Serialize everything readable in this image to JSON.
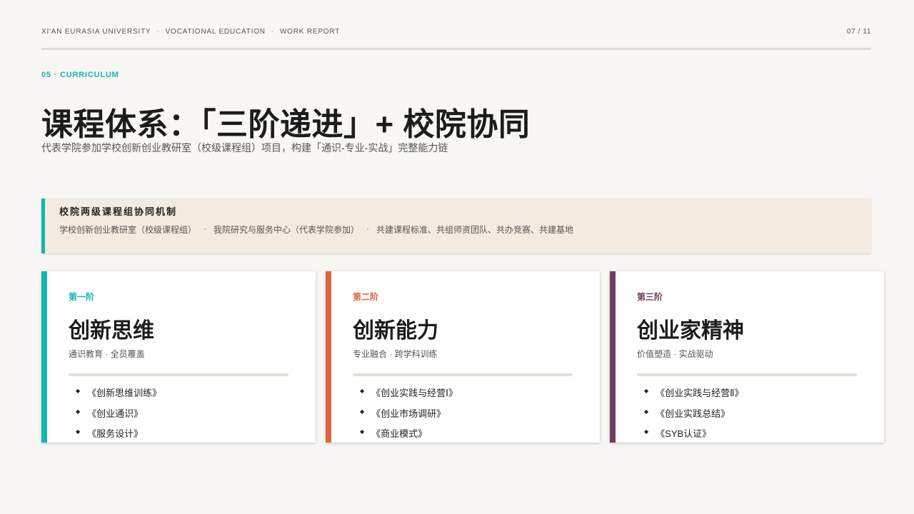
{
  "header": {
    "crumbs": [
      "XI'AN EURASIA UNIVERSITY",
      "VOCATIONAL EDUCATION",
      "WORK REPORT"
    ],
    "page_indicator": "07 / 11"
  },
  "section": {
    "tag": "05 · CURRICULUM",
    "title": "课程体系：「三阶递进」+ 校院协同",
    "subtitle": "代表学院参加学校创新创业教研室（校级课程组）项目，构建「通识-专业-实战」完整能力链"
  },
  "mechanism": {
    "title": "校院两级课程组协同机制",
    "items": [
      "学校创新创业教研室（校级课程组）",
      "我院研究与服务中心（代表学院参加）",
      "共建课程标准、共组师资团队、共办竞赛、共建基地"
    ],
    "accent": "#13b5ad"
  },
  "stages": [
    {
      "stage": "第一阶",
      "name": "创新思维",
      "desc": "通识教育 · 全员覆盖",
      "color": "#13b5ad",
      "courses": [
        "《创新思维训练》",
        "《创业通识》",
        "《服务设计》"
      ]
    },
    {
      "stage": "第二阶",
      "name": "创新能力",
      "desc": "专业融合 · 跨学科训练",
      "color": "#d9663c",
      "courses": [
        "《创业实践与经营Ⅰ》",
        "《创业市场调研》",
        "《商业模式》"
      ]
    },
    {
      "stage": "第三阶",
      "name": "创业家精神",
      "desc": "价值塑造 · 实战驱动",
      "color": "#6e3f5e",
      "courses": [
        "《创业实践与经营Ⅱ》",
        "《创业实践总结》",
        "《SYB认证》"
      ]
    }
  ]
}
